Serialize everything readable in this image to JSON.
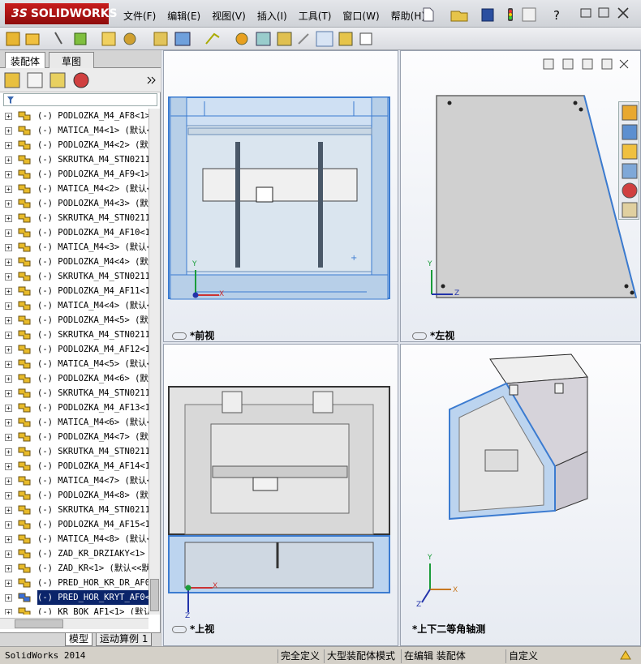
{
  "app": {
    "logo": "SOLIDWORKS",
    "logo_mark": "3S"
  },
  "menu": [
    "文件(F)",
    "编辑(E)",
    "视图(V)",
    "插入(I)",
    "工具(T)",
    "窗口(W)",
    "帮助(H)"
  ],
  "panel_tabs": {
    "assembly": "装配体",
    "sketch": "草图"
  },
  "tree": [
    {
      "label": "(-) PODLOZKA_M4_AF8<1>"
    },
    {
      "label": "(-) MATICA_M4<1> (默认<"
    },
    {
      "label": "(-) PODLOZKA_M4<2> (默认"
    },
    {
      "label": "(-) SKRUTKA_M4_STN02114"
    },
    {
      "label": "(-) PODLOZKA_M4_AF9<1>"
    },
    {
      "label": "(-) MATICA_M4<2> (默认<"
    },
    {
      "label": "(-) PODLOZKA_M4<3> (默认"
    },
    {
      "label": "(-) SKRUTKA_M4_STN02114"
    },
    {
      "label": "(-) PODLOZKA_M4_AF10<1>"
    },
    {
      "label": "(-) MATICA_M4<3> (默认<"
    },
    {
      "label": "(-) PODLOZKA_M4<4> (默认"
    },
    {
      "label": "(-) SKRUTKA_M4_STN02114"
    },
    {
      "label": "(-) PODLOZKA_M4_AF11<1>"
    },
    {
      "label": "(-) MATICA_M4<4> (默认<"
    },
    {
      "label": "(-) PODLOZKA_M4<5> (默认"
    },
    {
      "label": "(-) SKRUTKA_M4_STN02114"
    },
    {
      "label": "(-) PODLOZKA_M4_AF12<1>"
    },
    {
      "label": "(-) MATICA_M4<5> (默认<"
    },
    {
      "label": "(-) PODLOZKA_M4<6> (默认"
    },
    {
      "label": "(-) SKRUTKA_M4_STN02114"
    },
    {
      "label": "(-) PODLOZKA_M4_AF13<1>"
    },
    {
      "label": "(-) MATICA_M4<6> (默认<"
    },
    {
      "label": "(-) PODLOZKA_M4<7> (默认"
    },
    {
      "label": "(-) SKRUTKA_M4_STN02114"
    },
    {
      "label": "(-) PODLOZKA_M4_AF14<1>"
    },
    {
      "label": "(-) MATICA_M4<7> (默认<"
    },
    {
      "label": "(-) PODLOZKA_M4<8> (默认"
    },
    {
      "label": "(-) SKRUTKA_M4_STN02114"
    },
    {
      "label": "(-) PODLOZKA_M4_AF15<1>"
    },
    {
      "label": "(-) MATICA_M4<8> (默认<"
    },
    {
      "label": "(-) ZAD_KR_DRZIAKY<1> ("
    },
    {
      "label": "(-) ZAD_KR<1> (默认<<默"
    },
    {
      "label": "(-) PRED_HOR_KR_DR_AF0<"
    },
    {
      "label": "(-) PRED_HOR_KRYT_AF0<1",
      "selected": true
    },
    {
      "label": "(-) KR_BOK_AF1<1> (默认"
    }
  ],
  "bottom_tabs": {
    "model": "模型",
    "motion": "运动算例 1"
  },
  "views": {
    "front": "*前视",
    "left": "*左视",
    "top": "*上视",
    "iso": "*上下二等角轴测"
  },
  "axes": {
    "x": "X",
    "y": "Y",
    "z": "Z"
  },
  "status": {
    "app": "SolidWorks 2014",
    "defined": "完全定义",
    "mode": "大型装配体模式",
    "editing": "在编辑 装配体",
    "custom": "自定义"
  },
  "colors": {
    "accent_red": "#b5121b",
    "selection_blue": "#0a246a",
    "part_blue": "#bcd4ef"
  }
}
